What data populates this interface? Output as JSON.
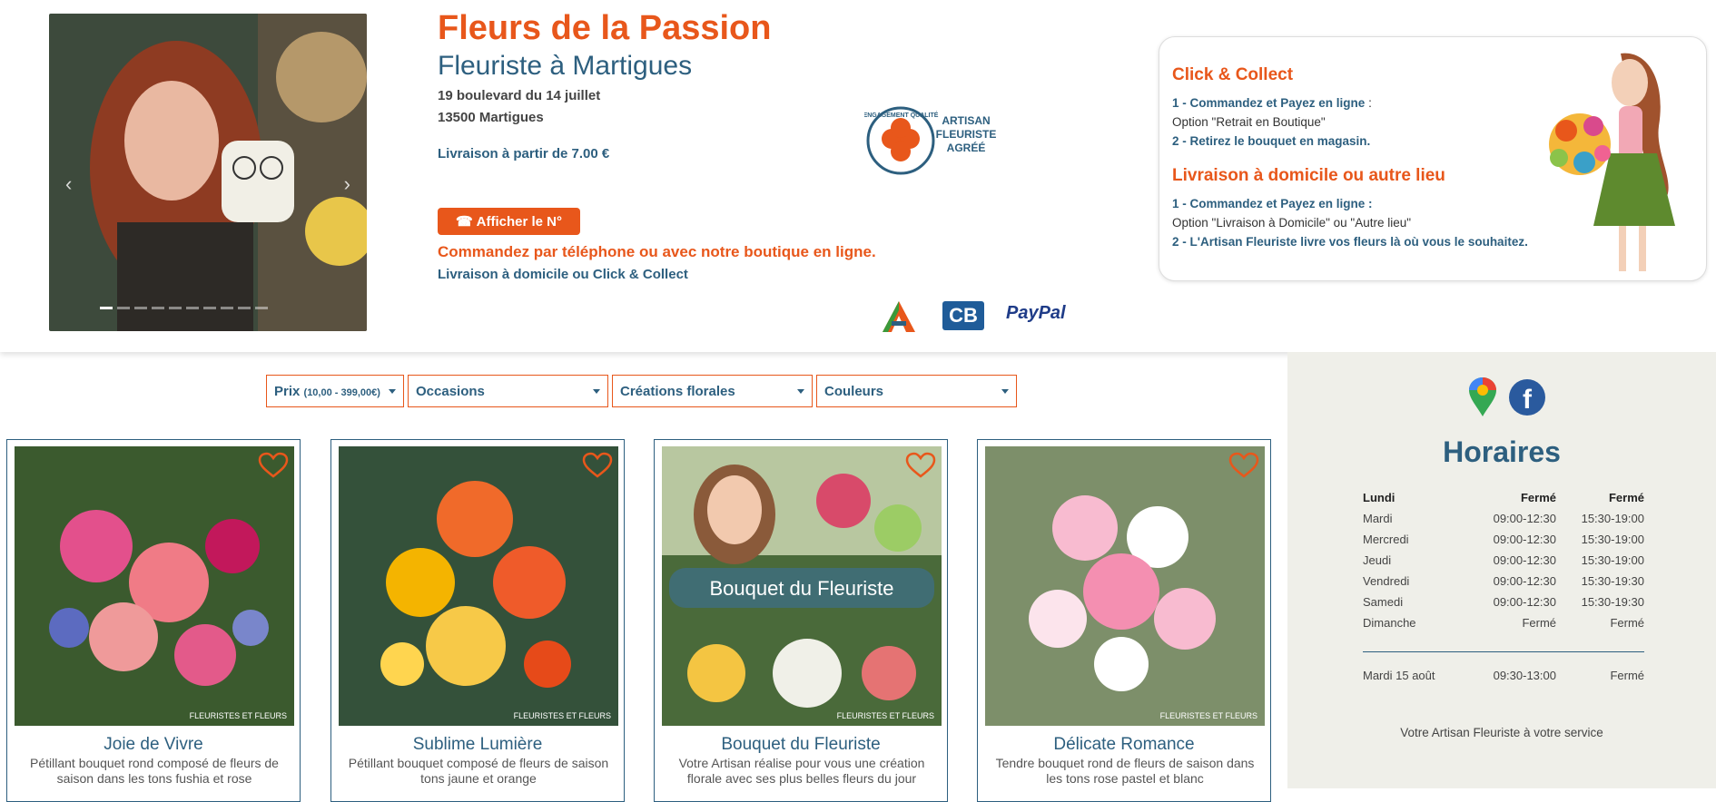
{
  "header": {
    "shop_name": "Fleurs de la Passion",
    "subtitle": "Fleuriste à Martigues",
    "address_line1": "19 boulevard du 14 juillet",
    "address_line2": "13500 Martigues",
    "delivery_from": "Livraison à partir de 7.00 €",
    "phone_button": "Afficher le N°",
    "order_line": "Commandez par téléphone ou avec notre boutique en ligne.",
    "delivery_line": "Livraison à domicile ou Click & Collect",
    "seal": {
      "ring_text": "ENGAGEMENT QUALITÉ",
      "line1": "ARTISAN",
      "line2": "FLEURISTE",
      "line3": "AGRÉÉ"
    },
    "payment": {
      "cb": "CB",
      "paypal": "PayPal"
    },
    "carousel": {
      "slides": 10,
      "active": 0
    }
  },
  "click_collect": {
    "title": "Click & Collect",
    "step1_bold": "1 - Commandez et Payez en ligne",
    "step1_rest": " :",
    "option1": "Option \"Retrait en Boutique\"",
    "step2": "2 - Retirez le bouquet en magasin.",
    "title2": "Livraison à domicile ou autre lieu",
    "step3": "1 - Commandez et Payez en ligne :",
    "option2": "Option \"Livraison à Domicile\" ou \"Autre lieu\"",
    "step4": "2 - L'Artisan Fleuriste livre vos fleurs là où vous le souhaitez."
  },
  "filters": {
    "price_label": "Prix",
    "price_range": "(10,00 - 399,00€)",
    "occasions": "Occasions",
    "creations": "Créations florales",
    "couleurs": "Couleurs"
  },
  "products": [
    {
      "name": "Joie de Vivre",
      "desc": "Pétillant bouquet rond composé de fleurs de saison dans les tons fushia et rose",
      "watermark": "FLEURISTES ET FLEURS"
    },
    {
      "name": "Sublime Lumière",
      "desc": "Pétillant bouquet composé de fleurs de saison tons jaune et orange",
      "watermark": "FLEURISTES ET FLEURS"
    },
    {
      "name": "Bouquet du Fleuriste",
      "desc": "Votre Artisan réalise pour vous une création florale avec ses plus belles fleurs du jour",
      "watermark": "FLEURISTES ET FLEURS",
      "overlay": "Bouquet du Fleuriste"
    },
    {
      "name": "Délicate Romance",
      "desc": "Tendre bouquet rond de fleurs de saison dans les tons rose pastel et blanc",
      "watermark": "FLEURISTES ET FLEURS"
    }
  ],
  "sidebar": {
    "hours_title": "Horaires",
    "hours": [
      {
        "day": "Lundi",
        "am": "Fermé",
        "pm": "Fermé"
      },
      {
        "day": "Mardi",
        "am": "09:00-12:30",
        "pm": "15:30-19:00"
      },
      {
        "day": "Mercredi",
        "am": "09:00-12:30",
        "pm": "15:30-19:00"
      },
      {
        "day": "Jeudi",
        "am": "09:00-12:30",
        "pm": "15:30-19:00"
      },
      {
        "day": "Vendredi",
        "am": "09:00-12:30",
        "pm": "15:30-19:30"
      },
      {
        "day": "Samedi",
        "am": "09:00-12:30",
        "pm": "15:30-19:30"
      },
      {
        "day": "Dimanche",
        "am": "Fermé",
        "pm": "Fermé"
      }
    ],
    "special": {
      "day": "Mardi 15 août",
      "am": "09:30-13:00",
      "pm": "Fermé"
    },
    "tagline": "Votre Artisan Fleuriste à votre service",
    "fb_letter": "f"
  },
  "colors": {
    "accent": "#e8571b",
    "brand": "#2d5f7f",
    "sidebar_bg": "#efefe9"
  }
}
